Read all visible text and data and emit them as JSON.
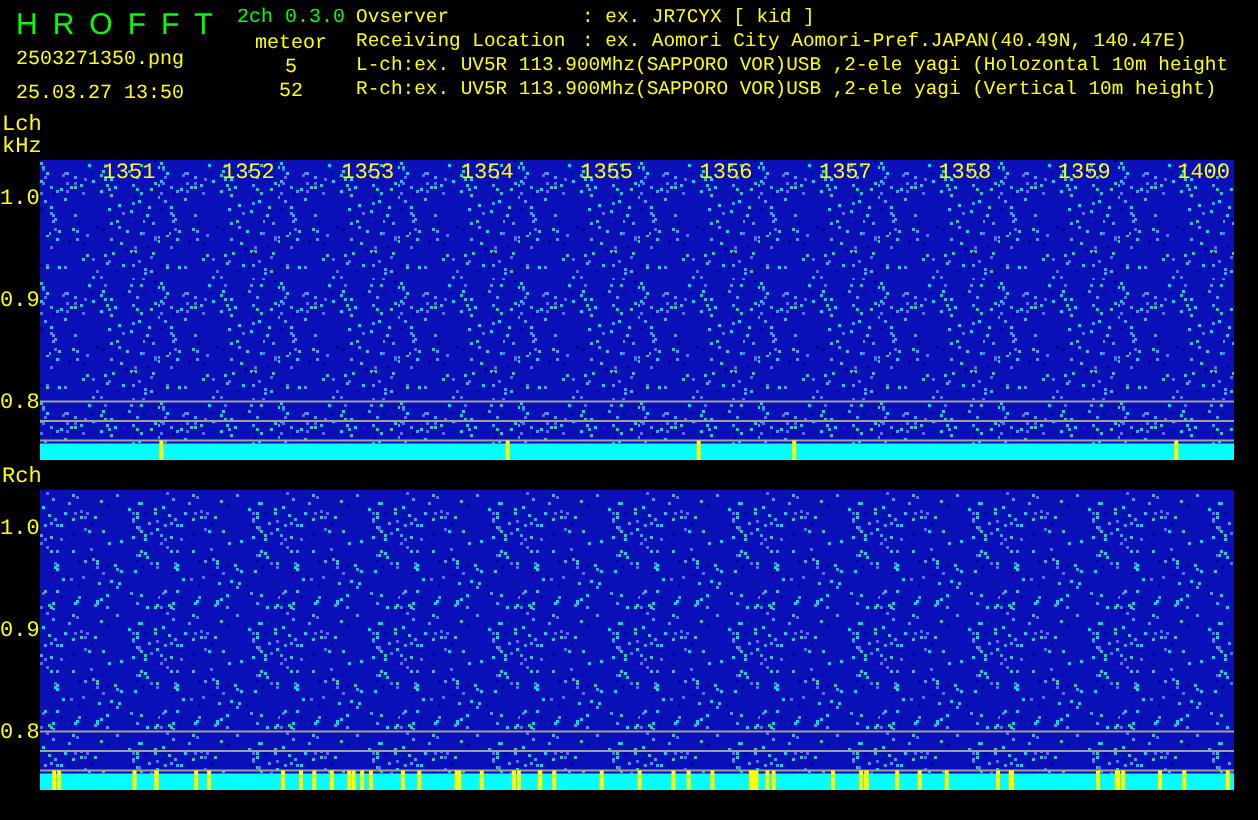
{
  "app": {
    "name": "HROFFT",
    "version": "2ch 0.3.0",
    "file": "2503271350.png",
    "datetime": "25.03.27 13:50"
  },
  "meteor": {
    "label": "meteor",
    "counts": [
      "5",
      "52"
    ]
  },
  "info": [
    {
      "label": "Ovserver",
      "value": ": ex. JR7CYX [ kid ]"
    },
    {
      "label": "Receiving Location",
      "value": ": ex. Aomori City Aomori-Pref.JAPAN(40.49N, 140.47E)"
    }
  ],
  "channel_lines": [
    "L-ch:ex. UV5R 113.900Mhz(SAPPORO VOR)USB ,2-ele yagi (Holozontal 10m height",
    "R-ch:ex. UV5R 113.900Mhz(SAPPORO VOR)USB ,2-ele yagi (Vertical 10m height)"
  ],
  "time_labels": [
    "1351",
    "1352",
    "1353",
    "1354",
    "1355",
    "1356",
    "1357",
    "1358",
    "1359",
    "1400"
  ],
  "channels": [
    {
      "label": "Lch",
      "unit": "kHz",
      "freq_labels": [
        "1.0",
        "0.9",
        "0.8"
      ]
    },
    {
      "label": "Rch",
      "freq_labels": [
        "1.0",
        "0.9",
        "0.8"
      ]
    }
  ]
}
